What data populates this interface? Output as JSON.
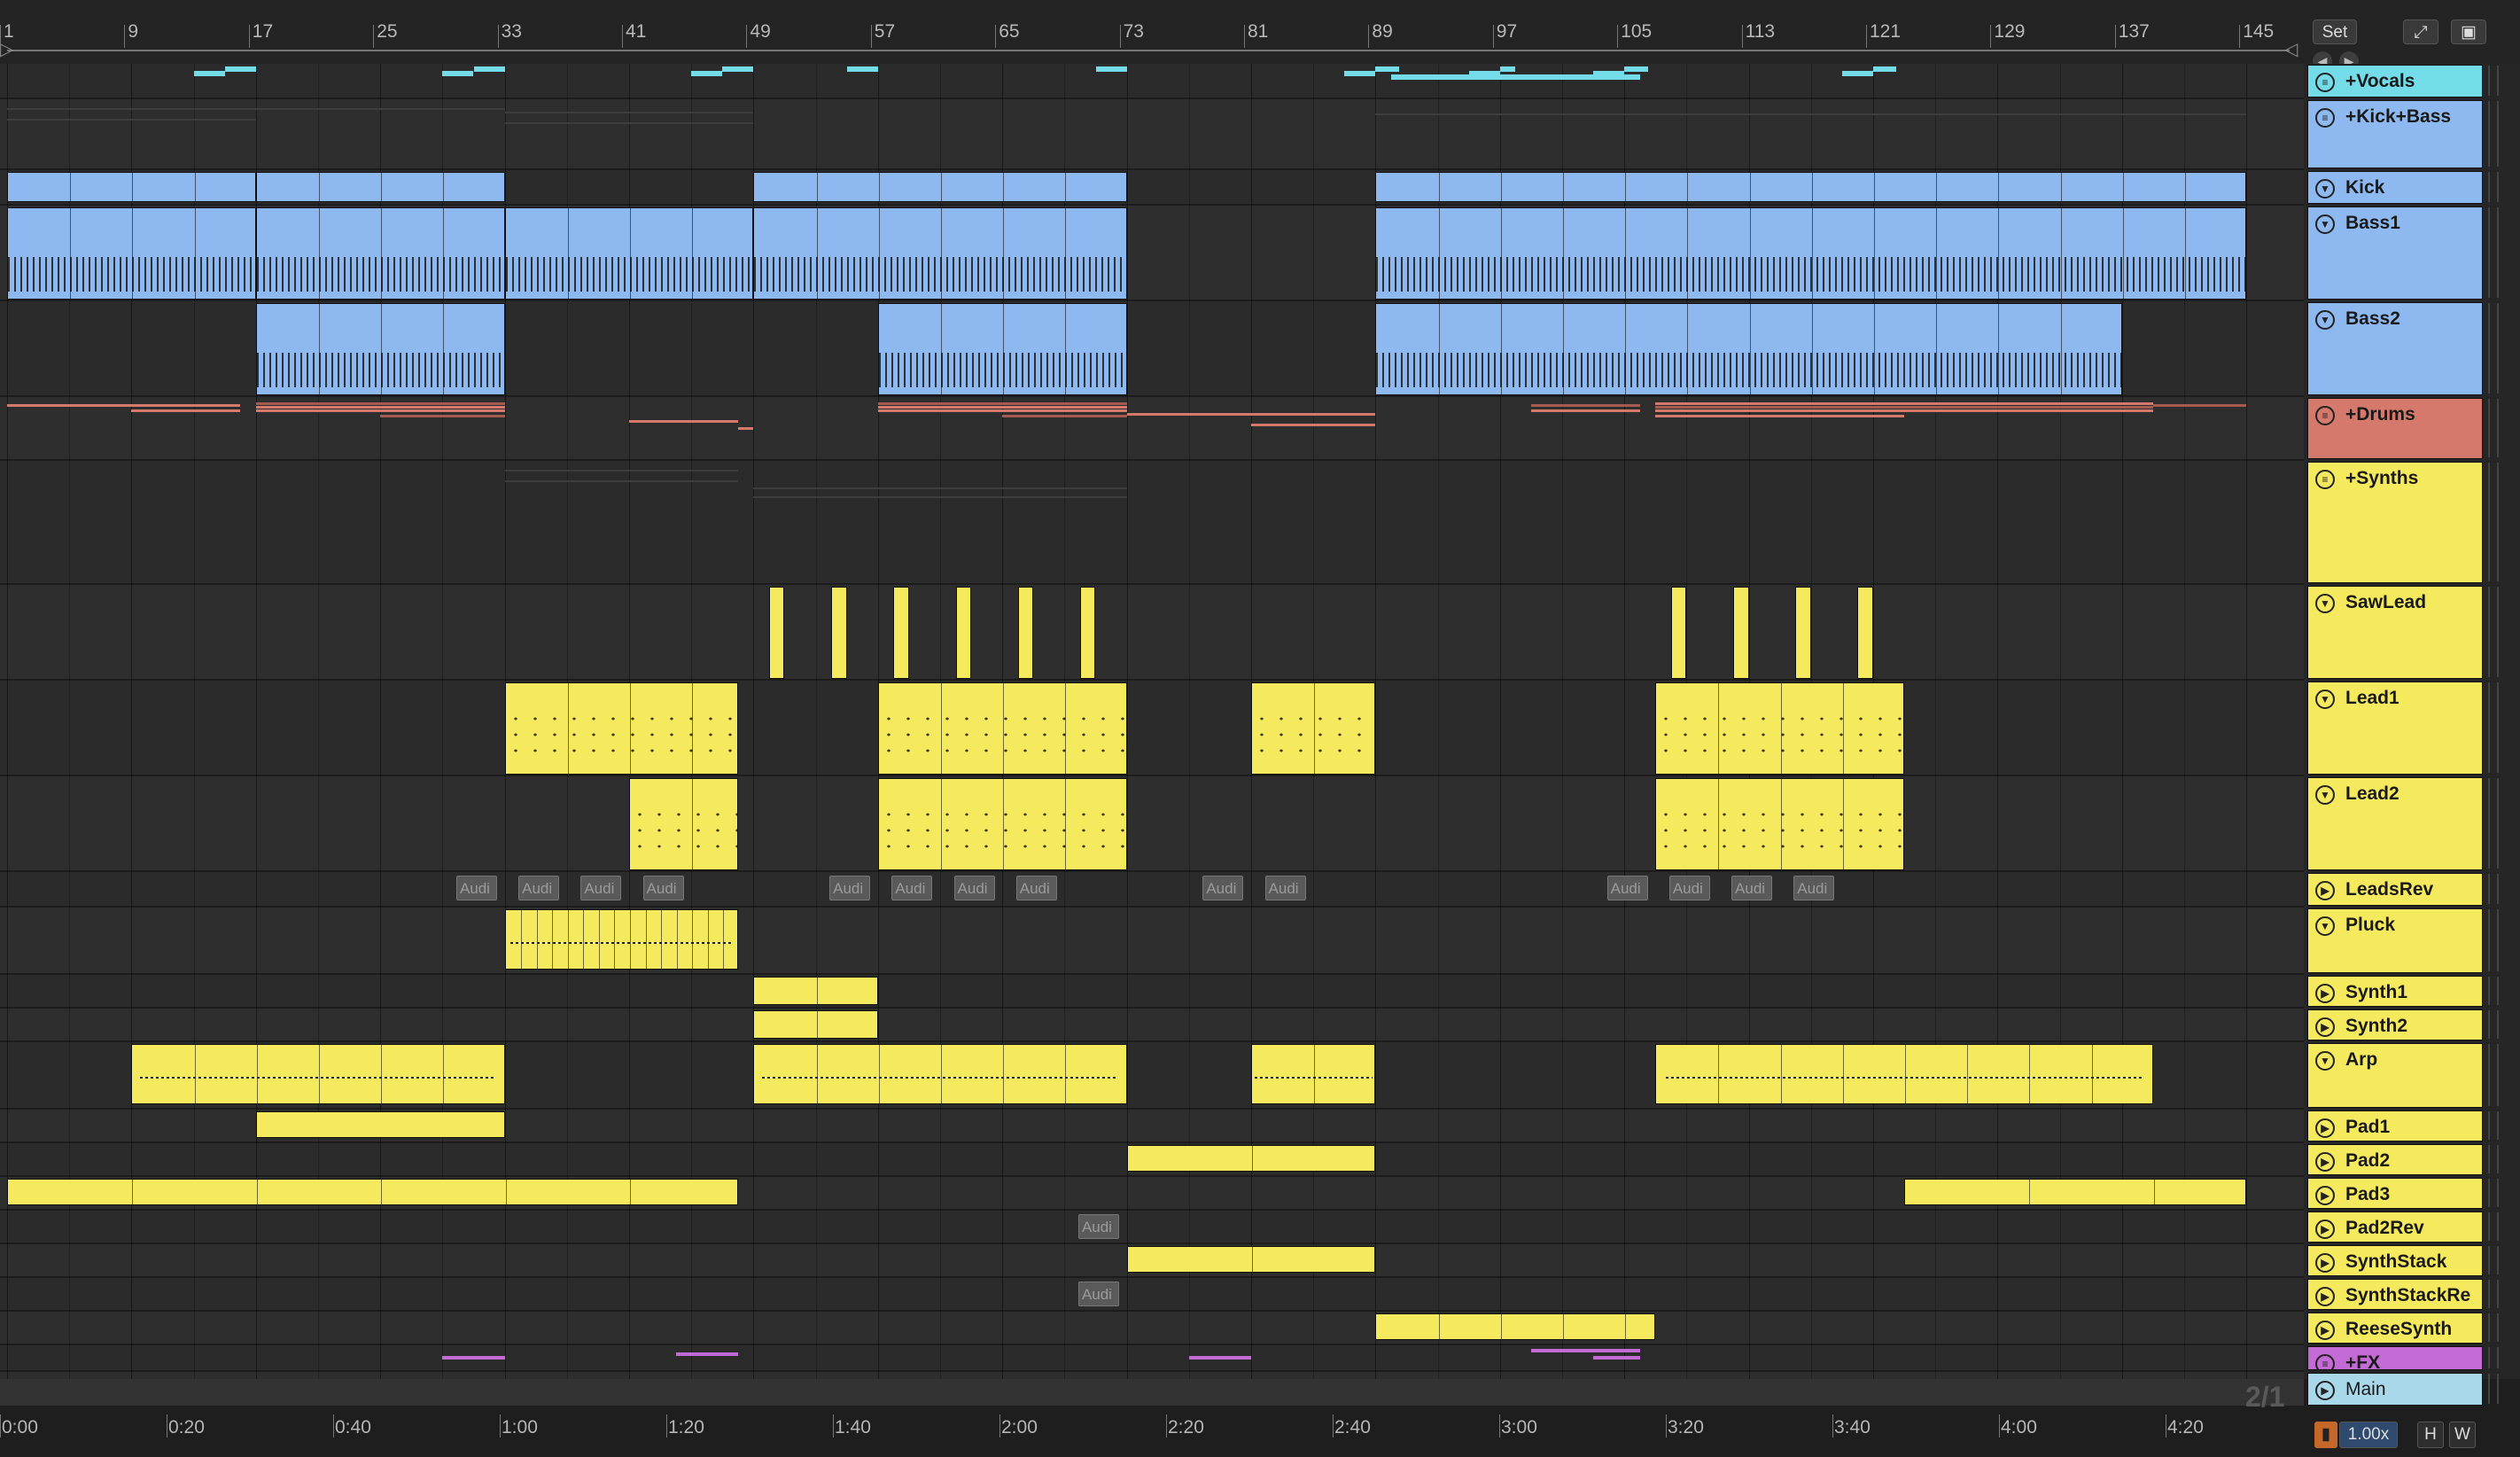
{
  "ruler": {
    "bars": [
      "1",
      "9",
      "17",
      "25",
      "33",
      "41",
      "49",
      "57",
      "65",
      "73",
      "81",
      "89",
      "97",
      "105",
      "113",
      "121",
      "129",
      "137",
      "145"
    ]
  },
  "time_ruler": {
    "labels": [
      "0:00",
      "0:20",
      "0:40",
      "1:00",
      "1:20",
      "1:40",
      "2:00",
      "2:20",
      "2:40",
      "3:00",
      "3:20",
      "3:40",
      "4:00",
      "4:20"
    ]
  },
  "top_controls": {
    "set_label": "Set",
    "expand_icon": "expand-icon",
    "lock_icon": "lock-icon",
    "back_icon": "arrow-left-icon",
    "forward_icon": "arrow-right-icon"
  },
  "time_signature": "2/1",
  "bottom_controls": {
    "zoom": "1.00x",
    "h_label": "H",
    "w_label": "W",
    "cpu_icon": "cpu-meter-icon"
  },
  "tracks": [
    {
      "name": "+Vocals",
      "type": "group",
      "color": "#74dbe8"
    },
    {
      "name": "+Kick+Bass",
      "type": "group",
      "color": "#8db9f0"
    },
    {
      "name": "Kick",
      "type": "midi",
      "color": "#8db9f0"
    },
    {
      "name": "Bass1",
      "type": "midi",
      "color": "#8db9f0"
    },
    {
      "name": "Bass2",
      "type": "midi",
      "color": "#8db9f0"
    },
    {
      "name": "+Drums",
      "type": "group",
      "color": "#d4796b"
    },
    {
      "name": "+Synths",
      "type": "group",
      "color": "#f5e95e"
    },
    {
      "name": "SawLead",
      "type": "midi",
      "color": "#f5e95e"
    },
    {
      "name": "Lead1",
      "type": "midi",
      "color": "#f5e95e"
    },
    {
      "name": "Lead2",
      "type": "midi",
      "color": "#f5e95e"
    },
    {
      "name": "LeadsRev",
      "type": "audio",
      "color": "#f5e95e"
    },
    {
      "name": "Pluck",
      "type": "midi",
      "color": "#f5e95e"
    },
    {
      "name": "Synth1",
      "type": "audio",
      "color": "#f5e95e"
    },
    {
      "name": "Synth2",
      "type": "audio",
      "color": "#f5e95e"
    },
    {
      "name": "Arp",
      "type": "midi",
      "color": "#f5e95e"
    },
    {
      "name": "Pad1",
      "type": "audio",
      "color": "#f5e95e"
    },
    {
      "name": "Pad2",
      "type": "audio",
      "color": "#f5e95e"
    },
    {
      "name": "Pad3",
      "type": "audio",
      "color": "#f5e95e"
    },
    {
      "name": "Pad2Rev",
      "type": "audio",
      "color": "#f5e95e"
    },
    {
      "name": "SynthStack",
      "type": "audio",
      "color": "#f5e95e"
    },
    {
      "name": "SynthStackRe",
      "type": "audio",
      "color": "#f5e95e"
    },
    {
      "name": "ReeseSynth",
      "type": "audio",
      "color": "#f5e95e"
    },
    {
      "name": "+FX",
      "type": "group",
      "color": "#c36ad6"
    },
    {
      "name": "Main",
      "type": "main",
      "color": "#a9d8ea"
    }
  ],
  "audio_chip_label": "Audi"
}
